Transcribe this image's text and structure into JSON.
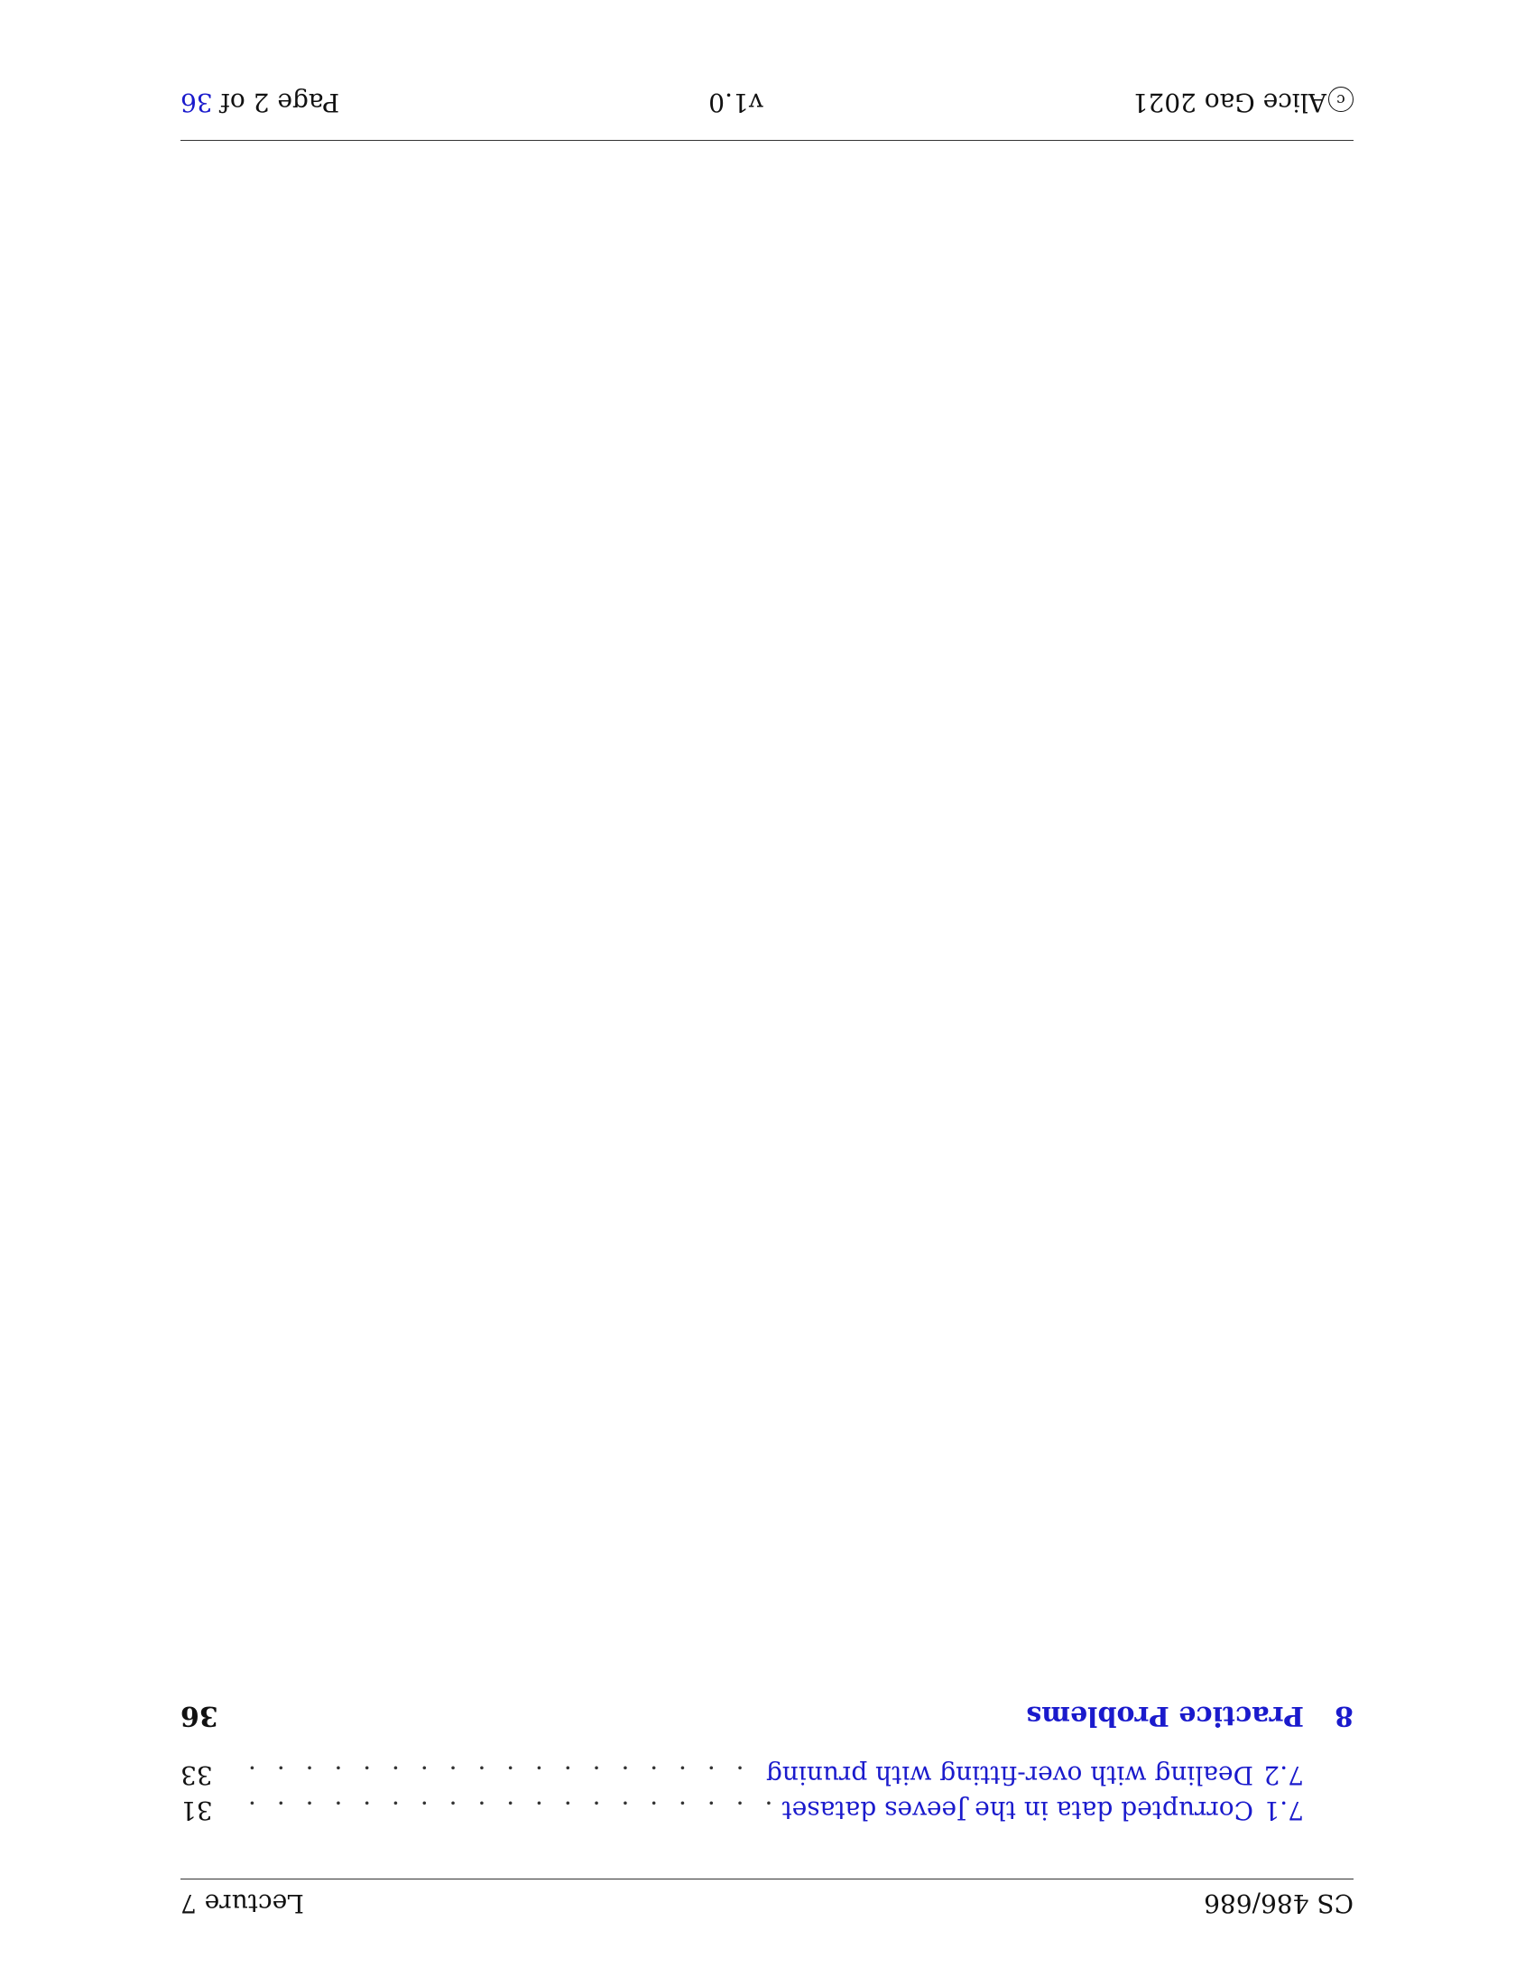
{
  "header": {
    "course": "CS 486/686",
    "lecture": "Lecture 7"
  },
  "toc": {
    "entries": [
      {
        "number": "7.1",
        "title": "Corrupted data in the Jeeves dataset",
        "page": "31"
      },
      {
        "number": "7.2",
        "title": "Dealing with over-fitting with pruning",
        "page": "33"
      }
    ],
    "section": {
      "number": "8",
      "title": "Practice Problems",
      "page": "36"
    }
  },
  "footer": {
    "copyright_symbol": "c",
    "author": "Alice Gao 2021",
    "version": "v1.0",
    "page_prefix": "Page 2 of ",
    "total_pages": "36"
  },
  "colors": {
    "link": "#1a1acc",
    "text": "#111111"
  }
}
